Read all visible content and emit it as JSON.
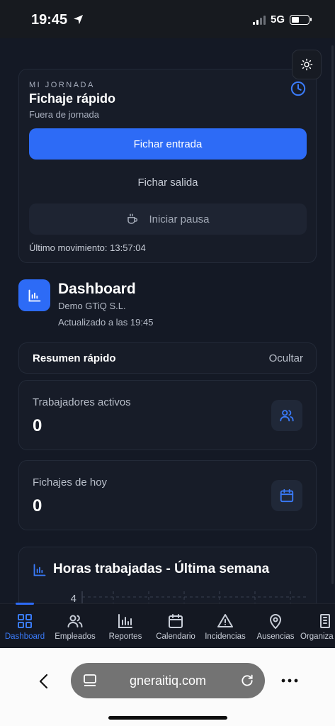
{
  "status_bar": {
    "time": "19:45",
    "network": "5G"
  },
  "jornada": {
    "overline": "MI JORNADA",
    "title": "Fichaje rápido",
    "subtitle": "Fuera de jornada",
    "primary_action": "Fichar entrada",
    "secondary_action": "Fichar salida",
    "pause_action": "Iniciar pausa",
    "last_movement": "Último movimiento: 13:57:04"
  },
  "dashboard": {
    "title": "Dashboard",
    "company": "Demo GTiQ S.L.",
    "updated": "Actualizado a las 19:45"
  },
  "resumen": {
    "title": "Resumen rápido",
    "toggle": "Ocultar"
  },
  "stats": [
    {
      "label": "Trabajadores activos",
      "value": "0",
      "icon": "users-icon"
    },
    {
      "label": "Fichajes de hoy",
      "value": "0",
      "icon": "calendar-icon"
    }
  ],
  "hours_chart": {
    "title": "Horas trabajadas - Última semana",
    "tick_label": "4"
  },
  "chart_data": {
    "type": "bar",
    "title": "Horas trabajadas - Última semana",
    "categories": [],
    "values": [],
    "ylim_visible_tick": 4,
    "grid": true
  },
  "bottom_nav": {
    "items": [
      {
        "label": "Dashboard",
        "icon": "grid-icon",
        "active": true
      },
      {
        "label": "Empleados",
        "icon": "users-icon",
        "active": false
      },
      {
        "label": "Reportes",
        "icon": "bar-chart-icon",
        "active": false
      },
      {
        "label": "Calendario",
        "icon": "calendar-icon",
        "active": false
      },
      {
        "label": "Incidencias",
        "icon": "warning-icon",
        "active": false
      },
      {
        "label": "Ausencias",
        "icon": "map-pin-icon",
        "active": false
      },
      {
        "label": "Organiza",
        "icon": "building-icon",
        "active": false
      }
    ]
  },
  "browser": {
    "url": "gneraitiq.com"
  },
  "colors": {
    "accent": "#2d6bf6",
    "background": "#141925",
    "card": "#171c28"
  }
}
